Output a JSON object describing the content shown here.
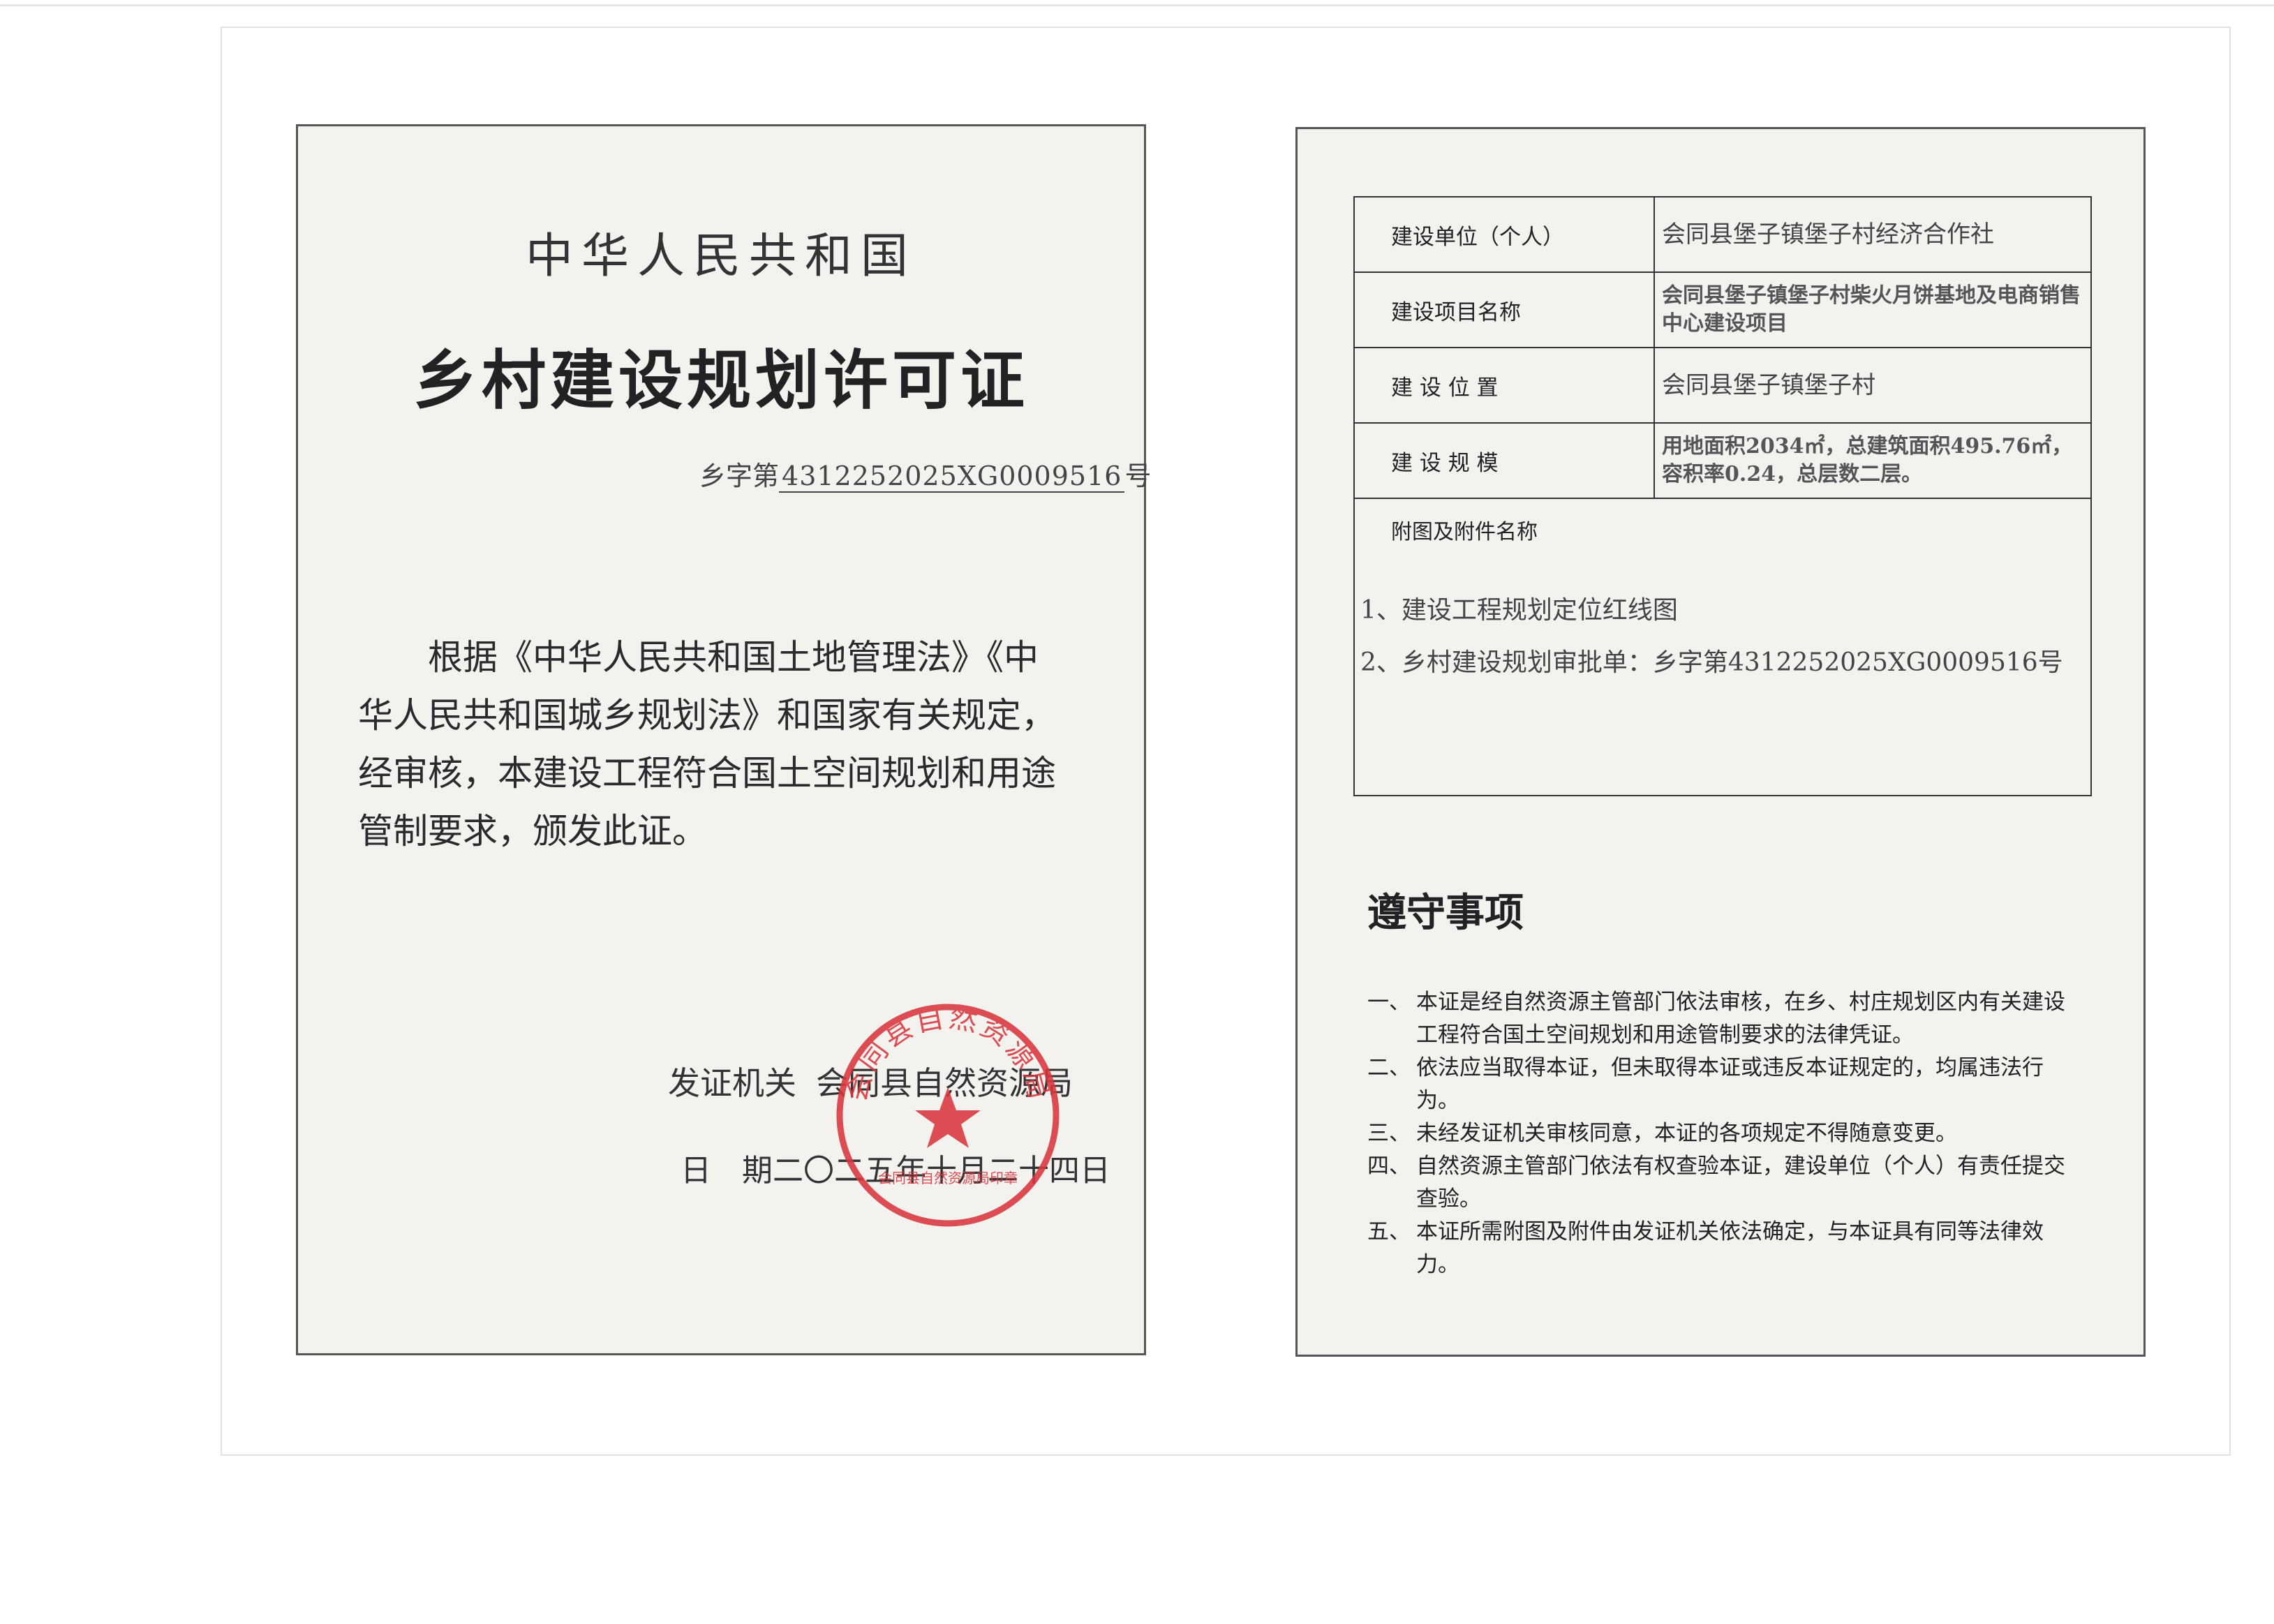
{
  "left": {
    "country": "中华人民共和国",
    "title": "乡村建设规划许可证",
    "number_prefix": "乡字第",
    "number": "4312252025XG0009516",
    "number_suffix": "号",
    "body_lines": [
      "根据《中华人民共和国土地管理法》《中",
      "华人民共和国城乡规划法》和国家有关规定，",
      "经审核，本建设工程符合国土空间规划和用途",
      "管制要求，颁发此证。"
    ],
    "issuer_label": "发证机关",
    "issuer": "会同县自然资源局",
    "date_label": "日　期",
    "date": "二〇二五年十月二十四日",
    "seal": {
      "ring_text": "会同县自然资源局",
      "bottom_text": "会同县自然资源局印章",
      "color": "#d9363e"
    }
  },
  "right": {
    "table": [
      {
        "label": "建设单位（个人）",
        "value": "会同县堡子镇堡子村经济合作社"
      },
      {
        "label": "建设项目名称",
        "value": "会同县堡子镇堡子村柴火月饼基地及电商销售中心建设项目"
      },
      {
        "label": "建 设 位 置",
        "value": "会同县堡子镇堡子村"
      },
      {
        "label": "建 设 规 模",
        "value": "用地面积2034㎡，总建筑面积495.76㎡，容积率0.24，总层数二层。"
      }
    ],
    "attachments_title": "附图及附件名称",
    "attachments": [
      "1、建设工程规划定位红线图",
      "2、乡村建设规划审批单：乡字第4312252025XG0009516号"
    ],
    "rules_title": "遵守事项",
    "rules": [
      {
        "num": "一、",
        "text": "本证是经自然资源主管部门依法审核，在乡、村庄规划区内有关建设工程符合国土空间规划和用途管制要求的法律凭证。"
      },
      {
        "num": "二、",
        "text": "依法应当取得本证，但未取得本证或违反本证规定的，均属违法行为。"
      },
      {
        "num": "三、",
        "text": "未经发证机关审核同意，本证的各项规定不得随意变更。"
      },
      {
        "num": "四、",
        "text": "自然资源主管部门依法有权查验本证，建设单位（个人）有责任提交查验。"
      },
      {
        "num": "五、",
        "text": "本证所需附图及附件由发证机关依法确定，与本证具有同等法律效力。"
      }
    ]
  }
}
